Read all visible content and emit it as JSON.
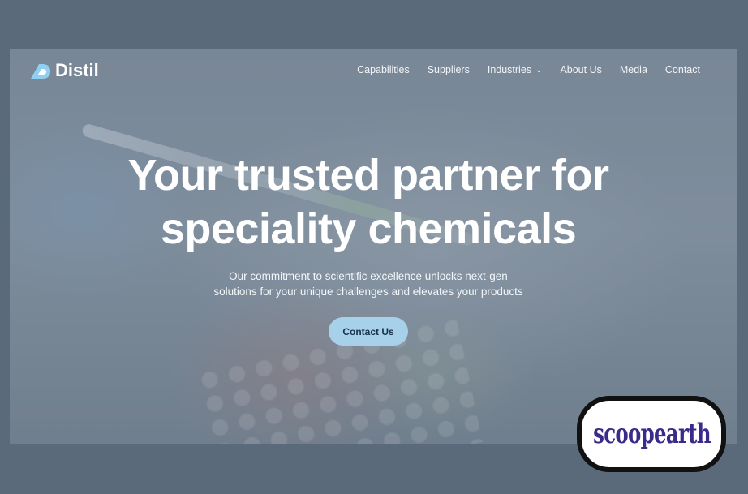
{
  "brand": {
    "name": "Distil",
    "logo_icon": "distil-d-logo-icon"
  },
  "nav": {
    "items": [
      {
        "label": "Capabilities"
      },
      {
        "label": "Suppliers"
      },
      {
        "label": "Industries",
        "has_dropdown": true
      },
      {
        "label": "About Us"
      },
      {
        "label": "Media"
      },
      {
        "label": "Contact"
      }
    ]
  },
  "hero": {
    "title_line1": "Your trusted partner for",
    "title_line2": "speciality chemicals",
    "subtitle_line1": "Our commitment to scientific excellence unlocks next-gen",
    "subtitle_line2": "solutions for your unique challenges and elevates your products",
    "cta_label": "Contact Us"
  },
  "watermark": {
    "text": "scoopearth"
  },
  "colors": {
    "background": "#5a6a7a",
    "cta": "#a7d0ea",
    "watermark_text": "#3b2a8a"
  }
}
